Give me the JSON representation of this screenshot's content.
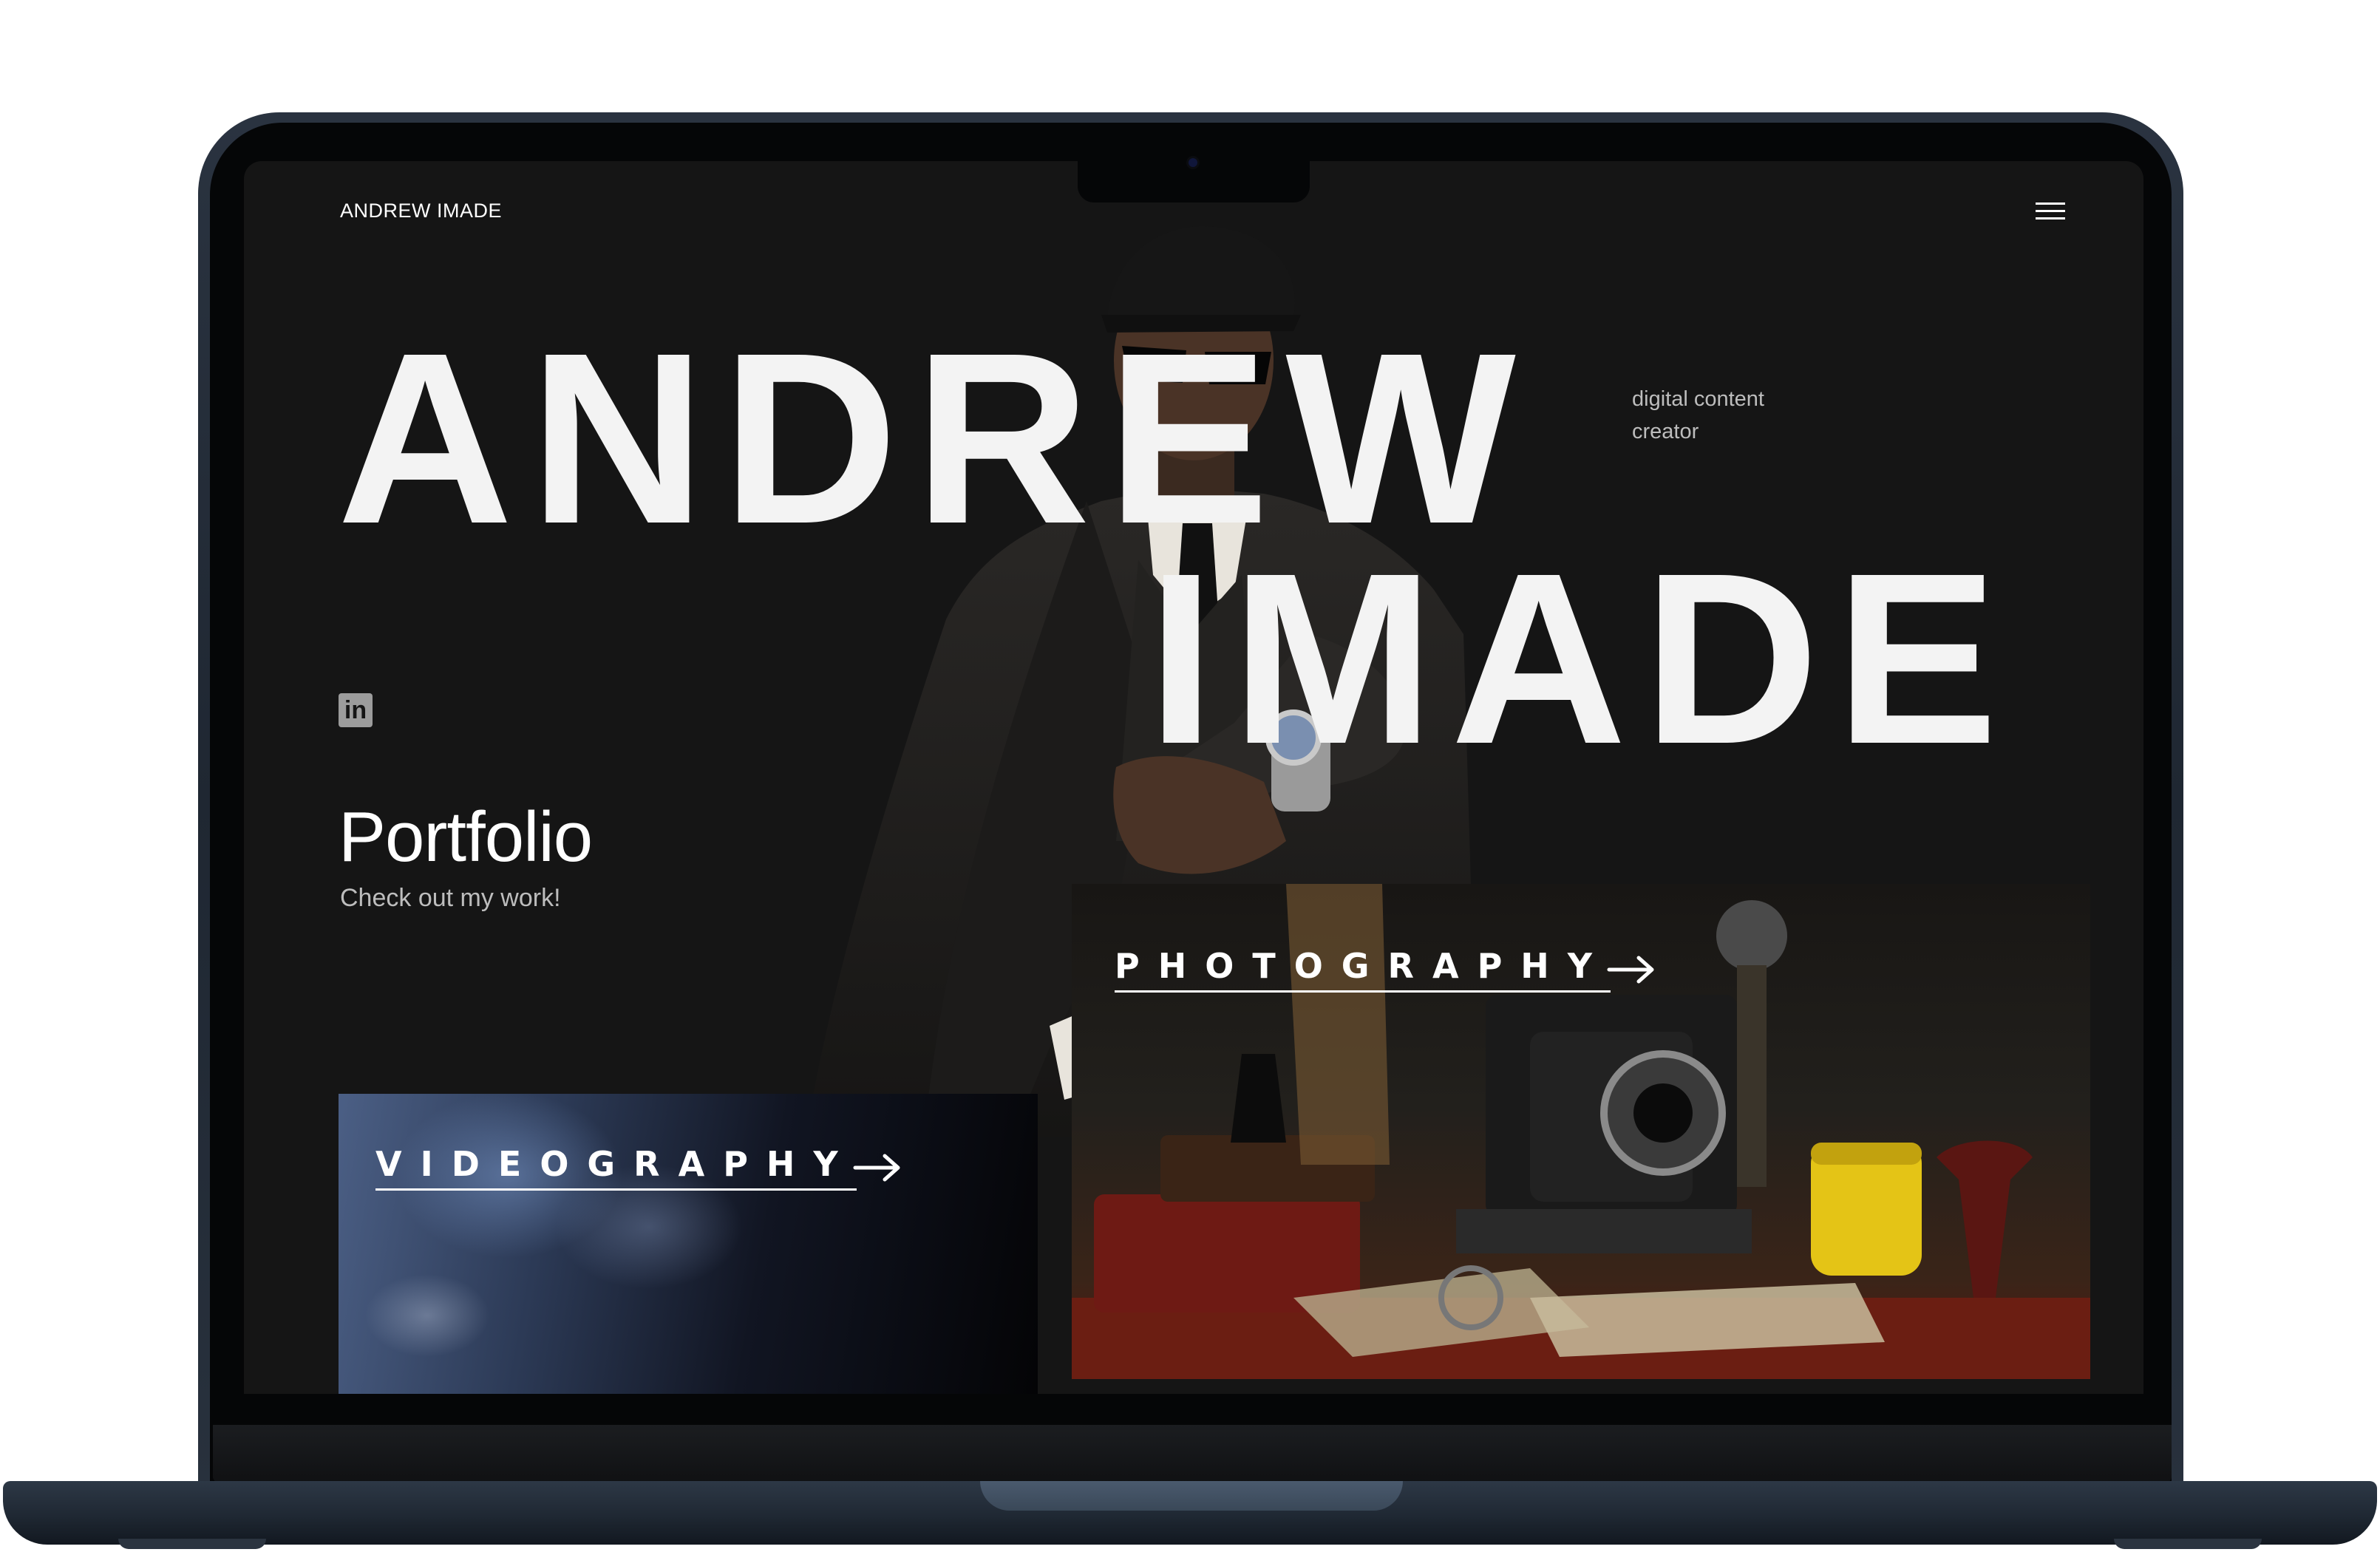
{
  "site": {
    "brand": "ANDREW IMADE",
    "menu_icon": "hamburger-menu-icon"
  },
  "hero": {
    "name_line1": "ANDREW",
    "name_line2": "IMADE",
    "tagline": "digital content creator"
  },
  "social": {
    "linkedin_icon": "linkedin-icon",
    "linkedin_text": "in"
  },
  "portfolio": {
    "title": "Portfolio",
    "subtitle": "Check out my work!"
  },
  "cards": {
    "videography": "VIDEOGRAPHY",
    "photography": "PHOTOGRAPHY"
  },
  "colors": {
    "screen_bg": "#151515",
    "text_primary": "#ffffff",
    "text_secondary": "#bdbdbd",
    "laptop_frame": "#1f2732"
  }
}
